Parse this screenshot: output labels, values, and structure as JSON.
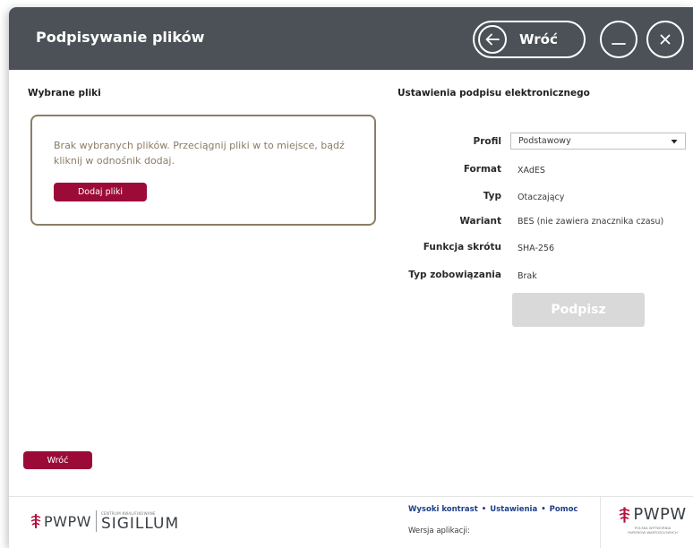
{
  "window": {
    "title": "Podpisywanie plików",
    "back_label": "Wróć"
  },
  "files": {
    "section_title": "Wybrane pliki",
    "empty_text": "Brak wybranych plików. Przeciągnij pliki w to miejsce, bądź kliknij w odnośnik dodaj.",
    "add_button": "Dodaj pliki"
  },
  "signature": {
    "section_title": "Ustawienia podpisu elektronicznego",
    "profile_label": "Profil",
    "profile_value": "Podstawowy",
    "format_label": "Format",
    "format_value": "XAdES",
    "type_label": "Typ",
    "type_value": "Otaczający",
    "variant_label": "Wariant",
    "variant_value": "BES (nie zawiera znacznika czasu)",
    "hash_label": "Funkcja skrótu",
    "hash_value": "SHA-256",
    "commitment_label": "Typ zobowiązania",
    "commitment_value": "Brak",
    "sign_button": "Podpisz"
  },
  "bottom": {
    "back_button": "Wróć"
  },
  "footer": {
    "logo_left_brand": "PWPW",
    "logo_left_small": "CENTRUM KWALIFIKOWANE",
    "logo_left_product": "SIGILLUM",
    "links": [
      "Wysoki kontrast",
      "Ustawienia",
      "Pomoc"
    ],
    "version_label": "Wersja aplikacji:",
    "logo_right_brand": "PWPW",
    "logo_right_caption_1": "POLSKA WYTWÓRNIA",
    "logo_right_caption_2": "PAPIERÓW WARTOŚCIOWYCH"
  },
  "colors": {
    "header_bg": "#4b5156",
    "accent": "#9c0b38",
    "dropzone_border": "#8b7d66",
    "link": "#1f3f8a",
    "disabled_button": "#d9d9d9"
  }
}
